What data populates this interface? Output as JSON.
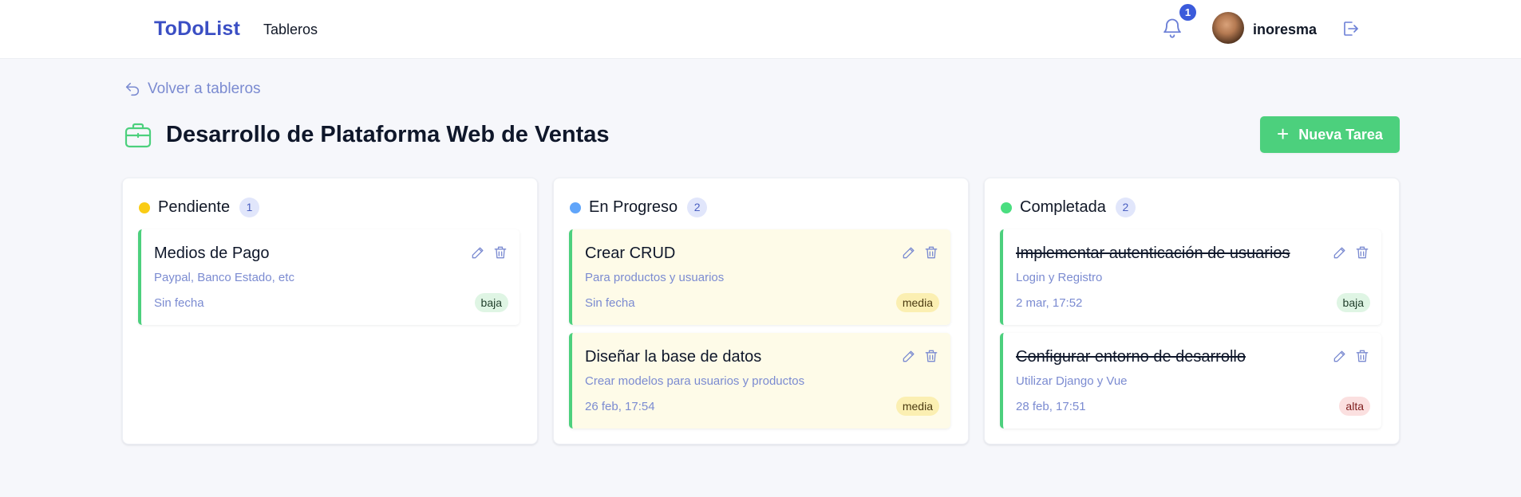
{
  "header": {
    "brand": "ToDoList",
    "nav_tableros": "Tableros",
    "notification_count": "1",
    "username": "inoresma"
  },
  "back_link": "Volver a tableros",
  "board": {
    "title": "Desarrollo de Plataforma Web de Ventas",
    "new_task_label": "Nueva Tarea"
  },
  "columns": [
    {
      "title": "Pendiente",
      "count": "1",
      "color": "#facc15",
      "cards": [
        {
          "title": "Medios de Pago",
          "desc": "Paypal, Banco Estado, etc",
          "date": "Sin fecha",
          "priority": "baja"
        }
      ]
    },
    {
      "title": "En Progreso",
      "count": "2",
      "color": "#60a5fa",
      "cards": [
        {
          "title": "Crear CRUD",
          "desc": "Para productos y usuarios",
          "date": "Sin fecha",
          "priority": "media"
        },
        {
          "title": "Diseñar la base de datos",
          "desc": "Crear modelos para usuarios y productos",
          "date": "26 feb, 17:54",
          "priority": "media"
        }
      ]
    },
    {
      "title": "Completada",
      "count": "2",
      "color": "#4ade80",
      "cards": [
        {
          "title": "Implementar autenticación de usuarios",
          "desc": "Login y Registro",
          "date": "2 mar, 17:52",
          "priority": "baja"
        },
        {
          "title": "Configurar entorno de desarrollo",
          "desc": "Utilizar Django y Vue",
          "date": "28 feb, 17:51",
          "priority": "alta"
        }
      ]
    }
  ],
  "colors": {
    "brand": "#3b4fc4",
    "accent_green": "#4cd07d",
    "muted_text": "#7b8bd1"
  },
  "icons": [
    "bell-icon",
    "logout-icon",
    "back-arrow-icon",
    "briefcase-icon",
    "plus-icon",
    "pencil-icon",
    "trash-icon"
  ]
}
